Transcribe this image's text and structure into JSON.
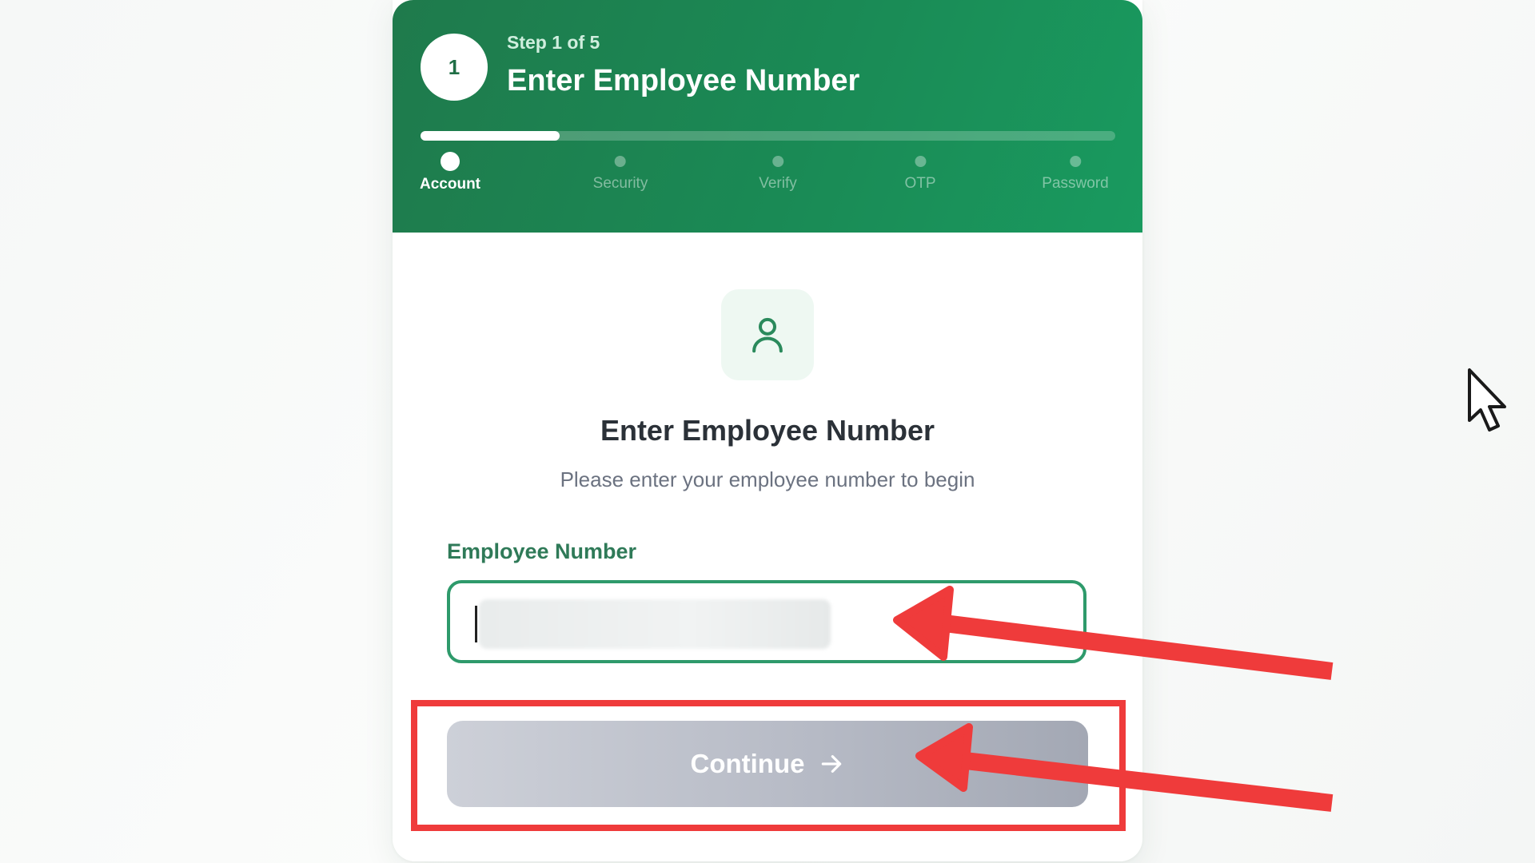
{
  "header": {
    "step_number": "1",
    "step_counter": "Step 1 of 5",
    "title": "Enter Employee Number",
    "progress": 0.2,
    "steps": [
      {
        "label": "Account",
        "active": true
      },
      {
        "label": "Security",
        "active": false
      },
      {
        "label": "Verify",
        "active": false
      },
      {
        "label": "OTP",
        "active": false
      },
      {
        "label": "Password",
        "active": false
      }
    ]
  },
  "main": {
    "icon": "user-icon",
    "title": "Enter Employee Number",
    "subtitle": "Please enter your employee number to begin",
    "field_label": "Employee Number",
    "field_value": "",
    "field_value_redacted": true,
    "continue_label": "Continue",
    "continue_icon": "arrow-right-icon"
  },
  "colors": {
    "header_green": "#1a8a55",
    "accent_green": "#2e9a6b",
    "annotation_red": "#ef3b3b",
    "button_disabled": "#b7bbc6"
  }
}
